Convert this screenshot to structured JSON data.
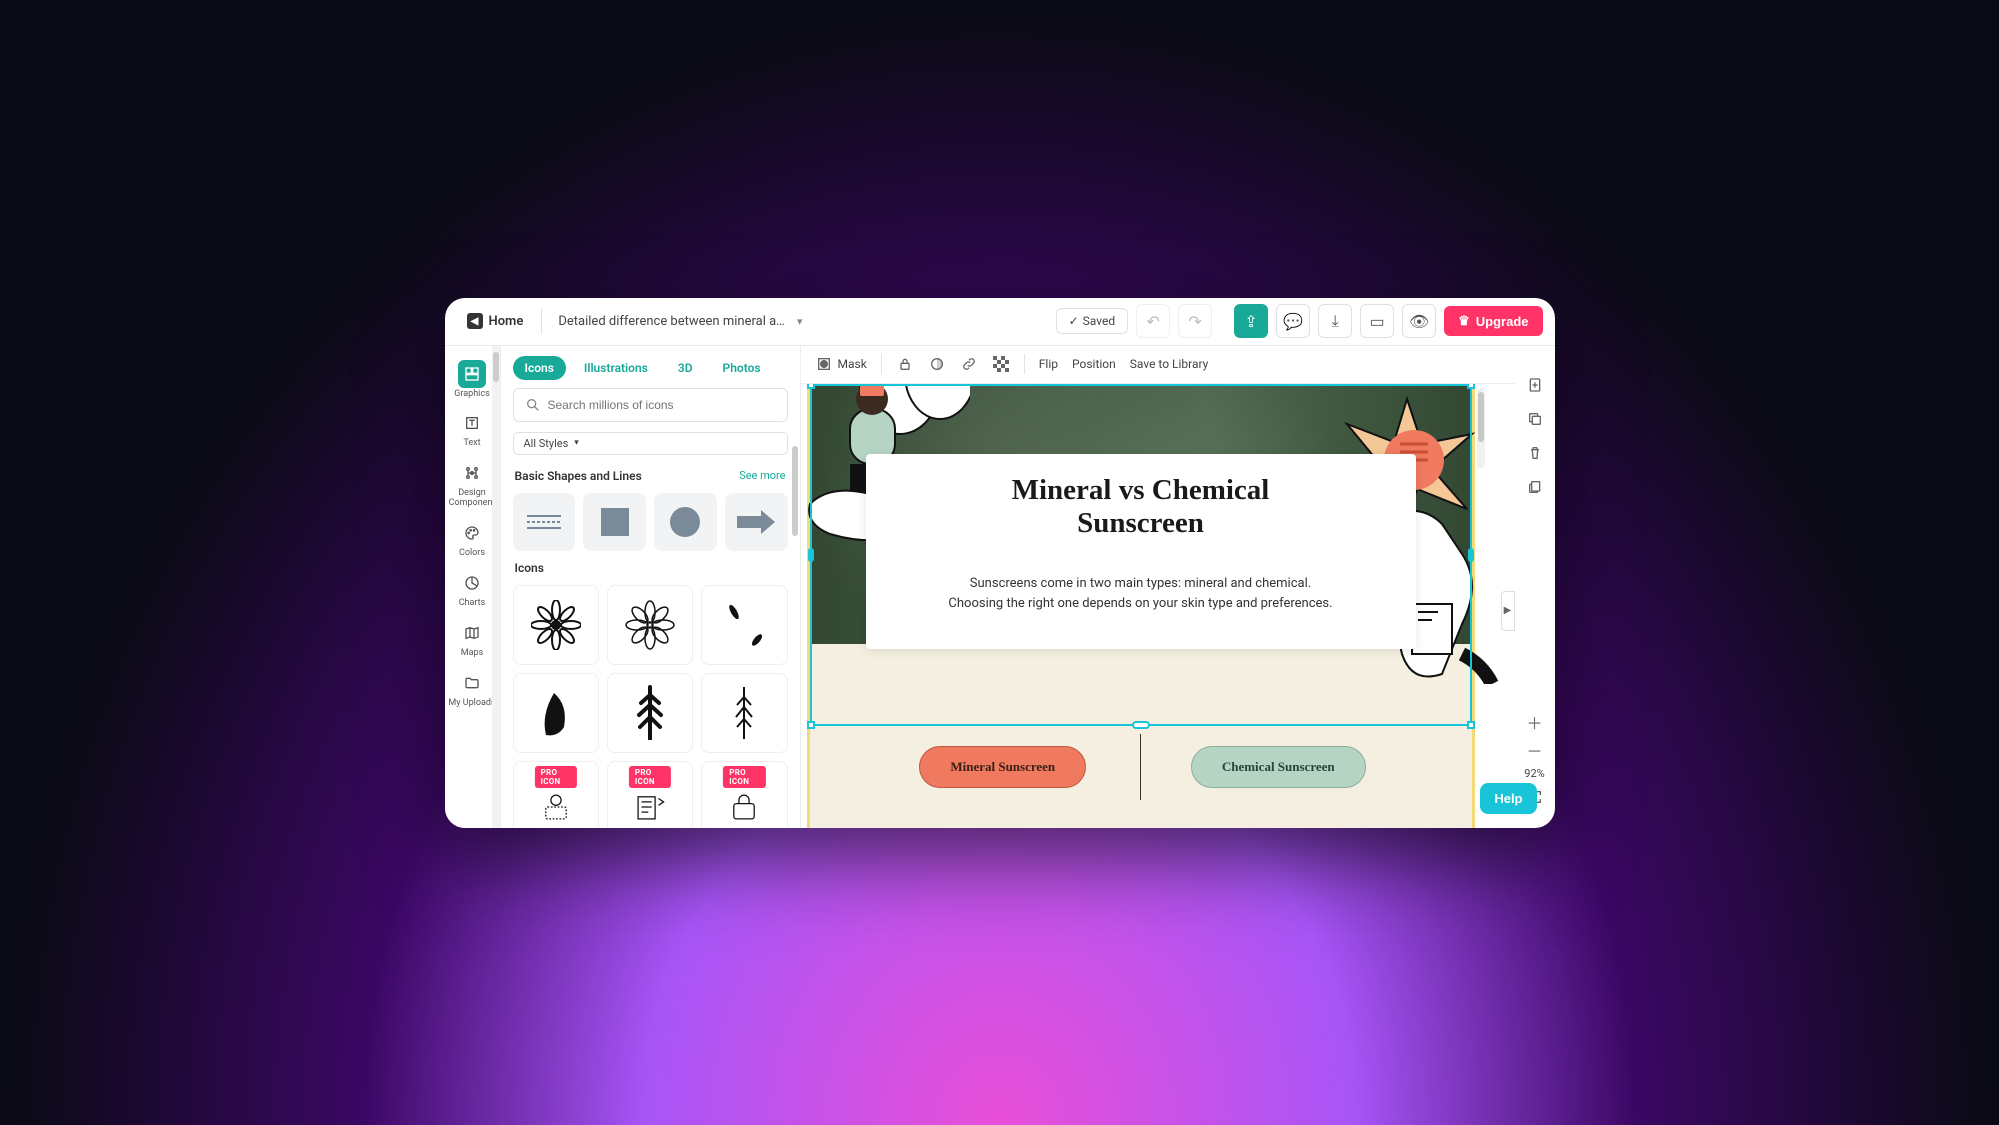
{
  "topbar": {
    "home_label": "Home",
    "doc_title": "Detailed difference between mineral and chemi",
    "saved_label": "Saved",
    "upgrade_label": "Upgrade"
  },
  "rail": {
    "items": [
      {
        "label": "Graphics",
        "icon": "graphics-icon"
      },
      {
        "label": "Text",
        "icon": "text-icon"
      },
      {
        "label": "Design Component",
        "icon": "components-icon"
      },
      {
        "label": "Colors",
        "icon": "colors-icon"
      },
      {
        "label": "Charts",
        "icon": "charts-icon"
      },
      {
        "label": "Maps",
        "icon": "maps-icon"
      },
      {
        "label": "My Uploads",
        "icon": "uploads-icon"
      }
    ]
  },
  "panel": {
    "tabs": [
      "Icons",
      "Illustrations",
      "3D",
      "Photos"
    ],
    "active_tab": 0,
    "search_placeholder": "Search millions of icons",
    "styles_label": "All Styles",
    "section_shapes": {
      "title": "Basic Shapes and Lines",
      "more": "See more"
    },
    "section_icons": {
      "title": "Icons"
    },
    "pro_badge": "PRO ICON"
  },
  "context_bar": {
    "mask": "Mask",
    "flip": "Flip",
    "position": "Position",
    "save": "Save to Library"
  },
  "canvas": {
    "title_line1": "Mineral vs Chemical",
    "title_line2": "Sunscreen",
    "body": "Sunscreens come in two main types: mineral and chemical. Choosing the right one depends on your skin type and preferences.",
    "pill_left": "Mineral Sunscreen",
    "pill_right": "Chemical Sunscreen"
  },
  "right": {
    "zoom": "92%"
  },
  "help_label": "Help"
}
